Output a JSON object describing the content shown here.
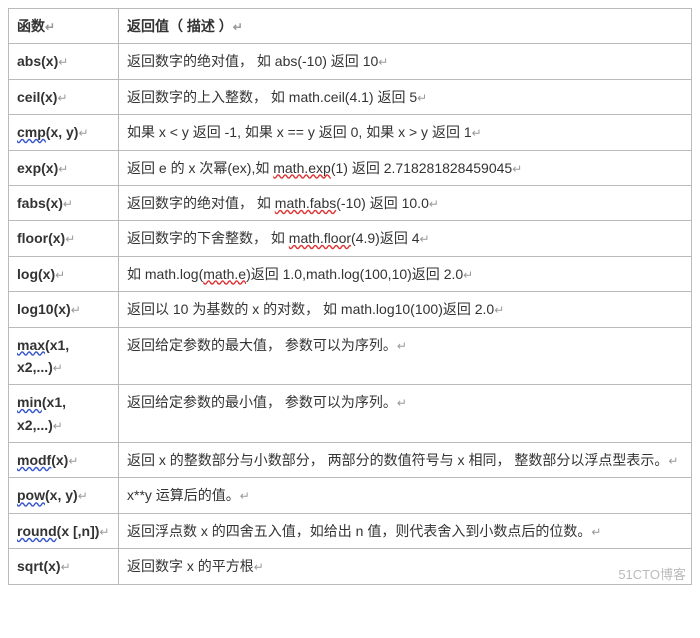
{
  "table": {
    "headers": {
      "func": "函数",
      "desc": "返回值（ 描述 ）"
    },
    "rows": [
      {
        "func": "abs(x)",
        "desc_pre": "返回数字的绝对值， 如 abs(-10)  返回  10"
      },
      {
        "func": "ceil(x)",
        "desc_pre": "返回数字的上入整数， 如 math.ceil(4.1)  返回  5"
      },
      {
        "func": "cmp(x, y)",
        "func_mark": "cmp",
        "func_sig": "(x, y)",
        "desc_pre": "如果  x < y  返回  -1, 如果  x == y  返回  0, 如果  x > y  返回  1"
      },
      {
        "func": "exp(x)",
        "desc_pre": "返回 e 的 x 次幂(ex),如 ",
        "desc_mark": "math.exp",
        "desc_post": "(1)  返回 2.718281828459045"
      },
      {
        "func": "fabs(x)",
        "desc_pre": "返回数字的绝对值， 如 ",
        "desc_mark": "math.fabs",
        "desc_post": "(-10)  返回 10.0"
      },
      {
        "func": "floor(x)",
        "desc_pre": "返回数字的下舍整数， 如 ",
        "desc_mark": "math.floor",
        "desc_post": "(4.9)返回  4"
      },
      {
        "func": "log(x)",
        "desc_pre": "如 math.log(",
        "desc_mark": "math.e",
        "desc_post": ")返回 1.0,math.log(100,10)返回 2.0"
      },
      {
        "func": "log10(x)",
        "desc_pre": "返回以 10 为基数的 x 的对数， 如 math.log10(100)返回  2.0"
      },
      {
        "func": "max(x1, x2,...)",
        "func_mark": "max",
        "func_sig": "(x1, x2,...)",
        "desc_pre": "返回给定参数的最大值， 参数可以为序列。"
      },
      {
        "func": "min(x1, x2,...)",
        "func_mark": "min",
        "func_sig": "(x1, x2,...)",
        "desc_pre": "返回给定参数的最小值， 参数可以为序列。"
      },
      {
        "func": "modf(x)",
        "func_mark": "modf",
        "func_sig": "(x)",
        "desc_pre": "返回 x 的整数部分与小数部分， 两部分的数值符号与 x 相同， 整数部分以浮点型表示。"
      },
      {
        "func": "pow(x, y)",
        "func_mark": "pow",
        "func_sig": "(x, y)",
        "desc_pre": "x**y 运算后的值。"
      },
      {
        "func": "round(x [,n])",
        "func_mark": "round",
        "func_sig": "(x [,n])",
        "desc_pre": "返回浮点数 x 的四舍五入值，如给出 n 值，则代表舍入到小数点后的位数。"
      },
      {
        "func": "sqrt(x)",
        "desc_pre": "返回数字 x 的平方根"
      }
    ]
  },
  "pilcrow": "↵",
  "watermark": "51CTO博客"
}
